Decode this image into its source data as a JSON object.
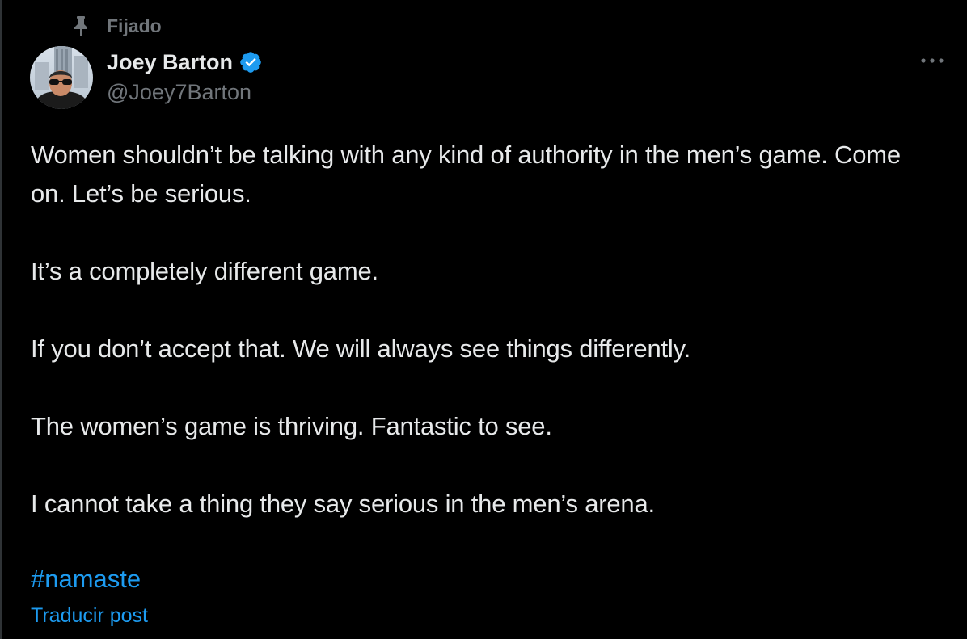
{
  "pinned": {
    "label": "Fijado",
    "icon": "pin-icon"
  },
  "author": {
    "display_name": "Joey Barton",
    "handle": "@Joey7Barton",
    "verified_icon": "verified-badge-icon",
    "verified_color": "#1d9bf0"
  },
  "more_icon": "more-options-icon",
  "tweet": {
    "lines": [
      "Women shouldn’t be talking with any kind of authority in the men’s game. Come on. Let’s be serious.",
      "It’s a completely different game.",
      "If you don’t accept that. We will always see things differently.",
      "The women’s game is thriving. Fantastic to see.",
      "I cannot take a thing they say serious in the men’s arena."
    ],
    "hashtag": "#namaste"
  },
  "translate_label": "Traducir post",
  "colors": {
    "background": "#000000",
    "text_primary": "#e7e9ea",
    "text_secondary": "#71767b",
    "link": "#1d9bf0"
  }
}
